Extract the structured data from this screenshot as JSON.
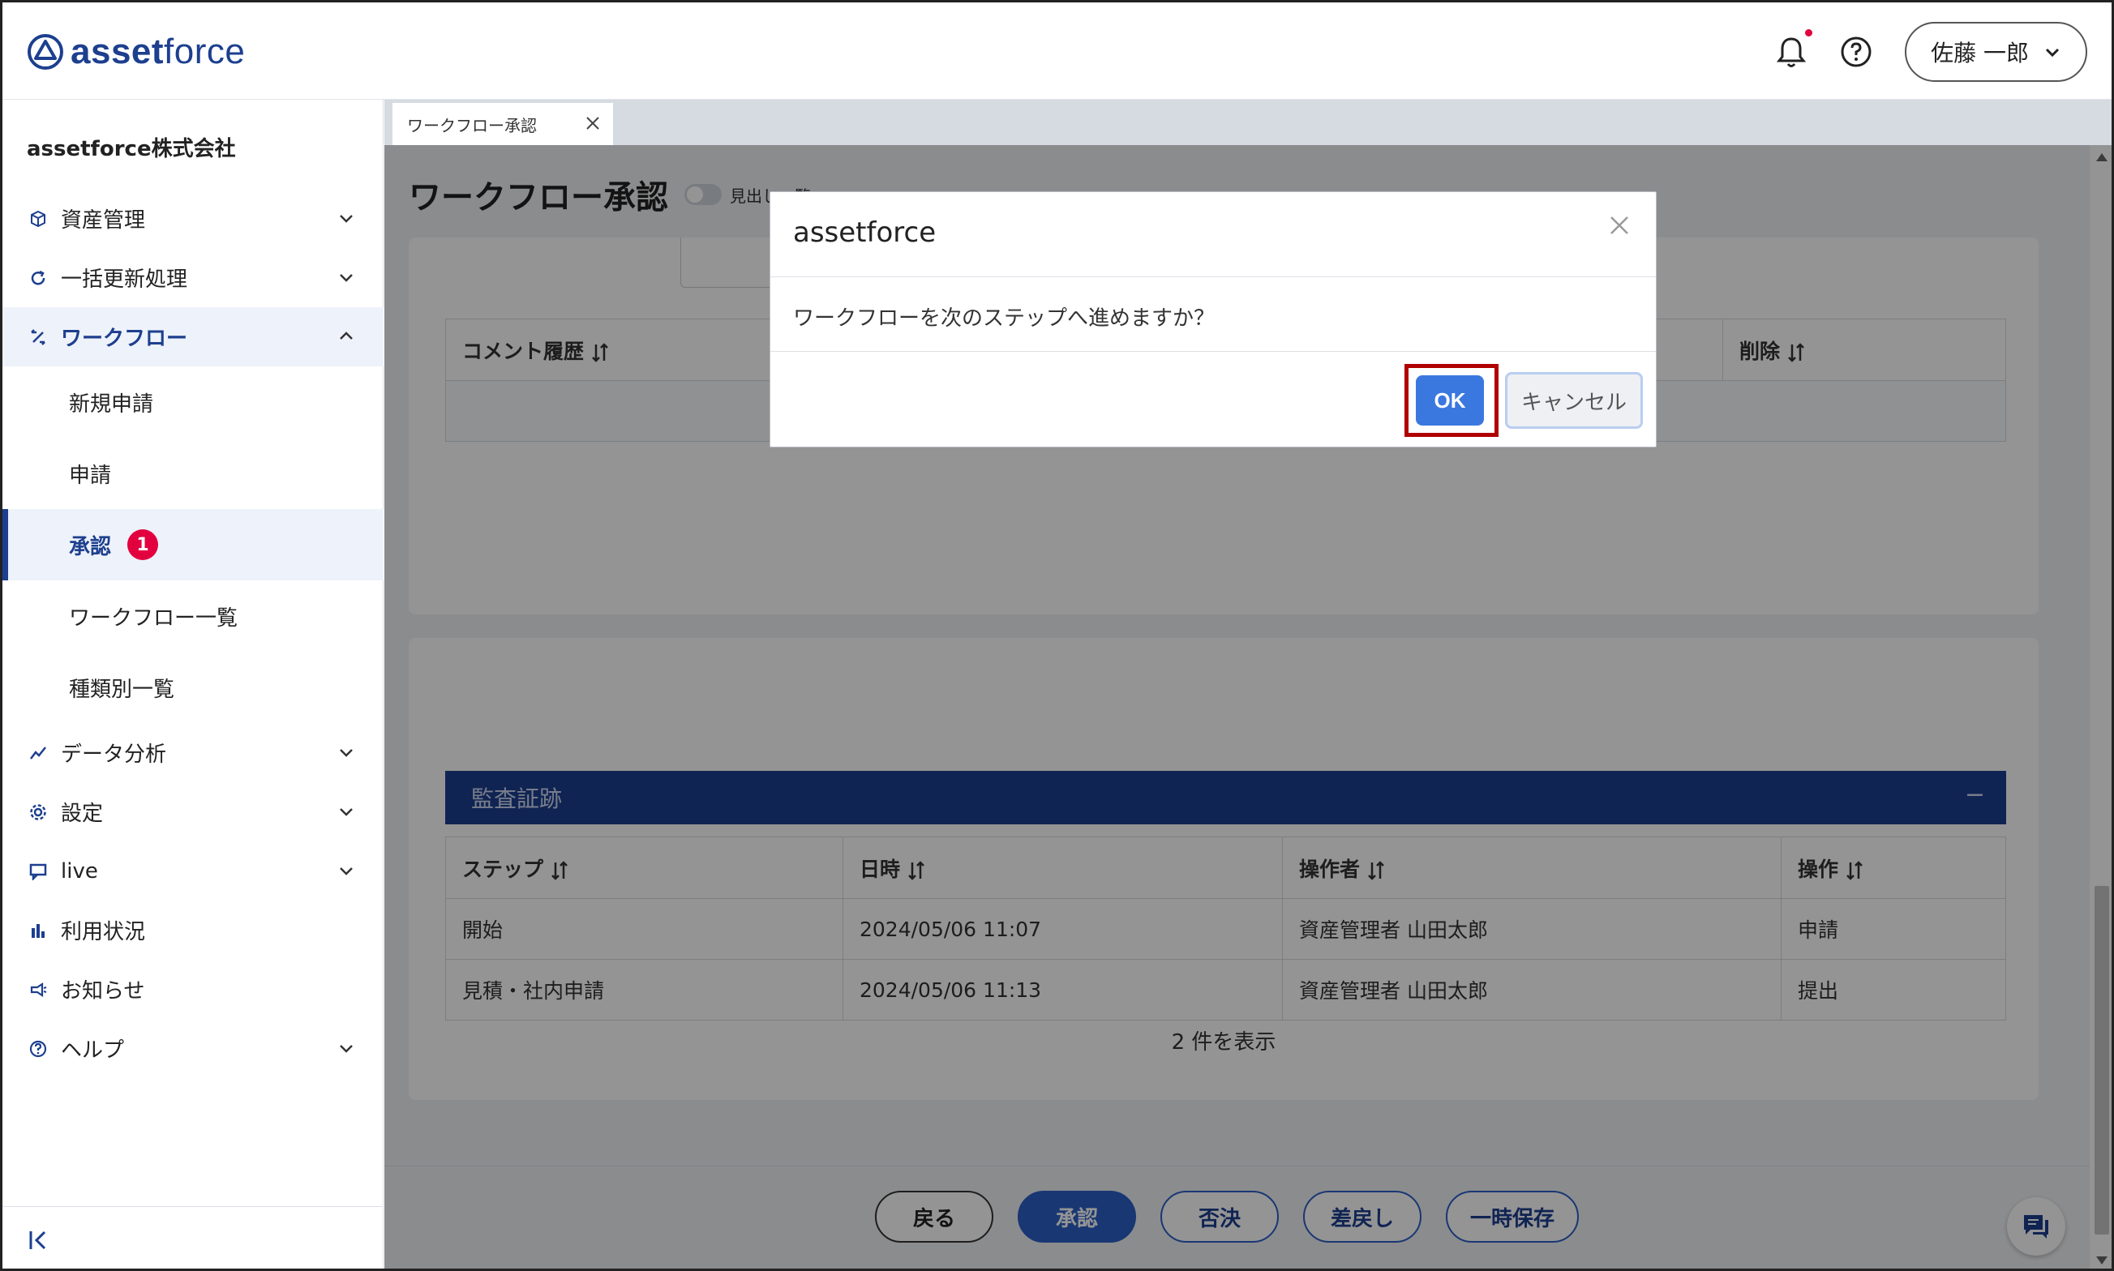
{
  "app": {
    "logo_text_1": "asset",
    "logo_text_2": "force",
    "user_name": "佐藤 一郎"
  },
  "sidebar": {
    "company": "assetforce株式会社",
    "items": [
      {
        "label": "資産管理",
        "icon": "cube-icon"
      },
      {
        "label": "一括更新処理",
        "icon": "refresh-icon"
      },
      {
        "label": "ワークフロー",
        "icon": "workflow-icon"
      },
      {
        "label": "データ分析",
        "icon": "analytics-icon"
      },
      {
        "label": "設定",
        "icon": "gear-icon"
      },
      {
        "label": "live",
        "icon": "live-chat-icon"
      },
      {
        "label": "利用状況",
        "icon": "bar-chart-icon"
      },
      {
        "label": "お知らせ",
        "icon": "megaphone-icon"
      },
      {
        "label": "ヘルプ",
        "icon": "help-icon"
      }
    ],
    "workflow_sub": [
      {
        "label": "新規申請"
      },
      {
        "label": "申請"
      },
      {
        "label": "承認",
        "badge": "1"
      },
      {
        "label": "ワークフロー一覧"
      },
      {
        "label": "種類別一覧"
      }
    ]
  },
  "main": {
    "tab_label": "ワークフロー承認",
    "page_title": "ワークフロー承認",
    "toggle_label": "見出し一覧",
    "comment_table": {
      "headers": [
        "コメント履歴",
        "削除"
      ]
    },
    "audit": {
      "title": "監査証跡",
      "collapse": "−",
      "headers": [
        "ステップ",
        "日時",
        "操作者",
        "操作"
      ],
      "rows": [
        [
          "開始",
          "2024/05/06 11:07",
          "資産管理者 山田太郎",
          "申請"
        ],
        [
          "見積・社内申請",
          "2024/05/06 11:13",
          "資産管理者 山田太郎",
          "提出"
        ]
      ],
      "count": "2 件を表示"
    },
    "footer_buttons": [
      "戻る",
      "承認",
      "否決",
      "差戻し",
      "一時保存"
    ]
  },
  "modal": {
    "title": "assetforce",
    "message": "ワークフローを次のステップへ進めますか？",
    "ok": "OK",
    "cancel": "キャンセル"
  },
  "colors": {
    "brand": "#1d3f8f",
    "primary_button": "#3a78e0",
    "badge": "#e2003f",
    "highlight": "#b00000"
  }
}
